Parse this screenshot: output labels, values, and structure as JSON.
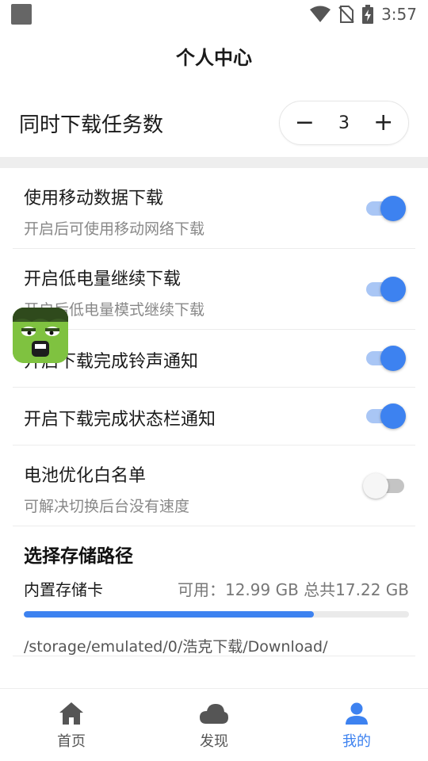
{
  "status_bar": {
    "time": "3:57"
  },
  "header": {
    "title": "个人中心"
  },
  "download_tasks": {
    "label": "同时下载任务数",
    "value": "3",
    "decrement": "−",
    "increment": "+"
  },
  "settings": [
    {
      "title": "使用移动数据下载",
      "subtitle": "开启后可使用移动网络下载",
      "enabled": true
    },
    {
      "title": "开启低电量继续下载",
      "subtitle": "开启后低电量模式继续下载",
      "enabled": true
    },
    {
      "title": "开启下载完成铃声通知",
      "subtitle": "",
      "enabled": true
    },
    {
      "title": "开启下载完成状态栏通知",
      "subtitle": "",
      "enabled": true
    },
    {
      "title": "电池优化白名单",
      "subtitle": "可解决切换后台没有速度",
      "enabled": false
    }
  ],
  "storage": {
    "title": "选择存储路径",
    "device": "内置存储卡",
    "availability": "可用：12.99 GB 总共17.22 GB",
    "used_fraction": 0.754,
    "path": "/storage/emulated/0/浩克下载/Download/"
  },
  "tabs": [
    {
      "label": "首页",
      "icon": "home-icon",
      "active": false
    },
    {
      "label": "发现",
      "icon": "cloud-icon",
      "active": false
    },
    {
      "label": "我的",
      "icon": "user-icon",
      "active": true
    }
  ],
  "colors": {
    "accent": "#3d82f0",
    "mascot": "#7fc240"
  }
}
